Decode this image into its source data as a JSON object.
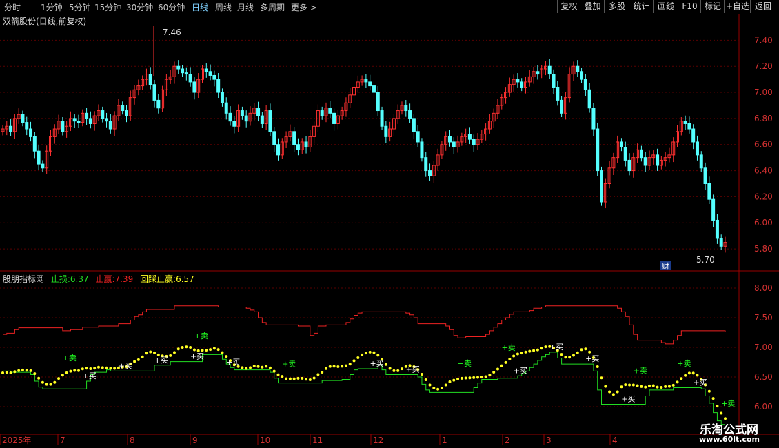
{
  "toolbar": {
    "periods": [
      "分时",
      "1分钟",
      "5分钟",
      "15分钟",
      "30分钟",
      "60分钟",
      "日线",
      "周线",
      "月线",
      "多周期",
      "更多 >"
    ],
    "active_period": "日线",
    "buttons": [
      "复权",
      "叠加",
      "多股",
      "统计",
      "画线",
      "F10",
      "标记",
      "+自选",
      "返回"
    ]
  },
  "main_panel": {
    "title": "双箭股份(日线,前复权)",
    "high_marker": "7.46",
    "low_marker": "5.70",
    "cai_badge": "财",
    "yaxis_ticks": [
      "7.40",
      "7.20",
      "7.00",
      "6.80",
      "6.60",
      "6.40",
      "6.20",
      "6.00",
      "5.80"
    ]
  },
  "indicator_panel": {
    "name": "股朋指标网",
    "stop_loss_label": "止损:",
    "stop_loss_value": "6.37",
    "take_profit_label": "止赢:",
    "take_profit_value": "7.39",
    "pullback_label": "回踩止赢:",
    "pullback_value": "6.57",
    "yaxis_ticks": [
      "8.00",
      "7.50",
      "7.00",
      "6.50",
      "6.00"
    ],
    "buy_label": "+买",
    "sell_label": "+卖"
  },
  "xaxis": {
    "labels": [
      "2025年",
      "7",
      "8",
      "9",
      "10",
      "11",
      "12",
      "1",
      "2",
      "3",
      "4"
    ]
  },
  "watermark": {
    "line1": "乐淘公式网",
    "line2": "www.60lt.com"
  },
  "colors": {
    "up": "#ff3030",
    "down": "#54ffff",
    "grid": "#5a0000",
    "stop_loss": "#22dd22",
    "take_profit": "#ee2222",
    "pullback": "#ffff22",
    "buy": "#ffffff",
    "sell": "#22ff22"
  },
  "chart_data": {
    "type": "candlestick",
    "ylim": [
      5.7,
      7.55
    ],
    "closes": [
      6.72,
      6.74,
      6.7,
      6.8,
      6.83,
      6.77,
      6.72,
      6.66,
      6.55,
      6.45,
      6.42,
      6.55,
      6.66,
      6.72,
      6.78,
      6.7,
      6.74,
      6.8,
      6.78,
      6.77,
      6.84,
      6.8,
      6.76,
      6.82,
      6.86,
      6.8,
      6.78,
      6.72,
      6.82,
      6.9,
      6.86,
      6.82,
      6.96,
      7.02,
      7.05,
      7.1,
      7.14,
      7.06,
      6.94,
      6.88,
      7.02,
      7.1,
      7.12,
      7.2,
      7.18,
      7.15,
      7.14,
      7.08,
      7.0,
      7.1,
      7.18,
      7.16,
      7.13,
      7.1,
      7.0,
      6.92,
      6.84,
      6.78,
      6.74,
      6.86,
      6.82,
      6.78,
      6.84,
      6.88,
      6.82,
      6.76,
      6.86,
      6.7,
      6.6,
      6.52,
      6.62,
      6.66,
      6.7,
      6.6,
      6.56,
      6.62,
      6.58,
      6.66,
      6.74,
      6.86,
      6.82,
      6.88,
      6.84,
      6.76,
      6.82,
      6.86,
      6.92,
      6.98,
      7.04,
      7.08,
      7.1,
      7.08,
      7.05,
      7.0,
      6.86,
      6.74,
      6.66,
      6.72,
      6.8,
      6.86,
      6.9,
      6.86,
      6.8,
      6.7,
      6.62,
      6.5,
      6.4,
      6.36,
      6.44,
      6.52,
      6.6,
      6.66,
      6.62,
      6.58,
      6.62,
      6.66,
      6.68,
      6.64,
      6.6,
      6.64,
      6.68,
      6.72,
      6.78,
      6.84,
      6.9,
      6.96,
      7.0,
      7.06,
      7.1,
      7.08,
      7.04,
      7.08,
      7.12,
      7.16,
      7.14,
      7.18,
      7.2,
      7.14,
      7.04,
      6.94,
      6.84,
      6.96,
      7.14,
      7.2,
      7.16,
      7.1,
      7.02,
      6.88,
      6.72,
      6.4,
      6.16,
      6.3,
      6.42,
      6.5,
      6.62,
      6.58,
      6.48,
      6.4,
      6.5,
      6.56,
      6.5,
      6.44,
      6.5,
      6.52,
      6.44,
      6.48,
      6.5,
      6.52,
      6.62,
      6.7,
      6.78,
      6.76,
      6.72,
      6.62,
      6.52,
      6.42,
      6.3,
      6.18,
      6.02,
      5.88,
      5.82,
      5.85
    ],
    "dates_marks": [
      "2025年",
      "7",
      "8",
      "9",
      "10",
      "11",
      "12",
      "1",
      "2",
      "3",
      "4"
    ],
    "high": 7.46,
    "low": 5.7
  }
}
